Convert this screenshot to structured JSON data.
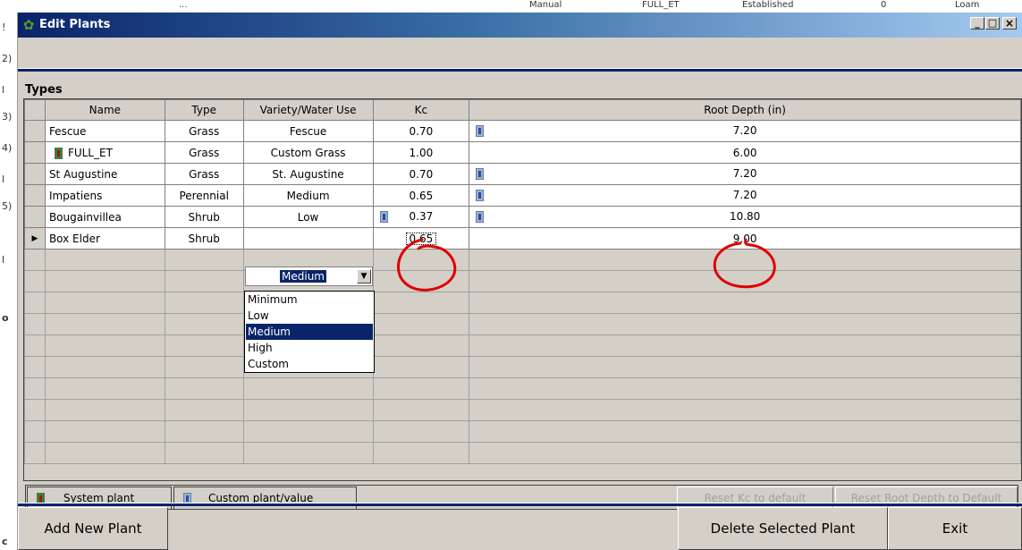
{
  "background_window": {
    "header_fragments": [
      "...",
      "Manual",
      "FULL_ET",
      "Established",
      "0",
      "Loam"
    ],
    "left_fragments": [
      "!",
      "2)",
      "l",
      "3)",
      "4)",
      "l",
      "5)",
      "l",
      "o",
      "c"
    ]
  },
  "window": {
    "title": "Edit Plants",
    "controls": {
      "minimize": "_",
      "maximize": "□",
      "close": "×"
    }
  },
  "types_panel": {
    "label": "Types",
    "columns": [
      "Name",
      "Type",
      "Variety/Water Use",
      "Kc",
      "Root Depth (in)"
    ],
    "rows": [
      {
        "name": "Fescue",
        "type": "Grass",
        "variety": "Fescue",
        "kc": "0.70",
        "root_depth": "7.20",
        "name_icon": "",
        "kc_icon": "",
        "root_icon": "custom-plant-icon"
      },
      {
        "name": "FULL_ET",
        "type": "Grass",
        "variety": "Custom Grass",
        "kc": "1.00",
        "root_depth": "6.00",
        "name_icon": "system-plant-icon",
        "kc_icon": "",
        "root_icon": ""
      },
      {
        "name": "St Augustine",
        "type": "Grass",
        "variety": "St. Augustine",
        "kc": "0.70",
        "root_depth": "7.20",
        "name_icon": "",
        "kc_icon": "",
        "root_icon": "custom-plant-icon"
      },
      {
        "name": "Impatiens",
        "type": "Perennial",
        "variety": "Medium",
        "kc": "0.65",
        "root_depth": "7.20",
        "name_icon": "",
        "kc_icon": "",
        "root_icon": "custom-plant-icon"
      },
      {
        "name": "Bougainvillea",
        "type": "Shrub",
        "variety": "Low",
        "kc": "0.37",
        "root_depth": "10.80",
        "name_icon": "",
        "kc_icon": "custom-plant-icon",
        "root_icon": "custom-plant-icon"
      },
      {
        "name": "Box Elder",
        "type": "Shrub",
        "variety": "Medium",
        "kc": "0.65",
        "root_depth": "9.00",
        "name_icon": "",
        "kc_icon": "",
        "root_icon": "",
        "current": true
      }
    ],
    "current_row_marker": "▶",
    "variety_editor": {
      "value": "Medium",
      "options": [
        "Minimum",
        "Low",
        "Medium",
        "High",
        "Custom"
      ],
      "selected": "Medium"
    }
  },
  "legend": {
    "system_plant": "System plant",
    "custom_plant": "Custom plant/value",
    "reset_kc": "Reset Kc to default",
    "reset_root": "Reset Root Depth to Default"
  },
  "buttons": {
    "add": "Add New Plant",
    "delete": "Delete Selected Plant",
    "exit": "Exit"
  },
  "colors": {
    "title_start": "#0a246a",
    "title_end": "#a6caf0",
    "selection": "#0a246a",
    "annotation": "#e00000",
    "system_icon": "#2c8a2c",
    "custom_icon": "#2c4e8e"
  }
}
